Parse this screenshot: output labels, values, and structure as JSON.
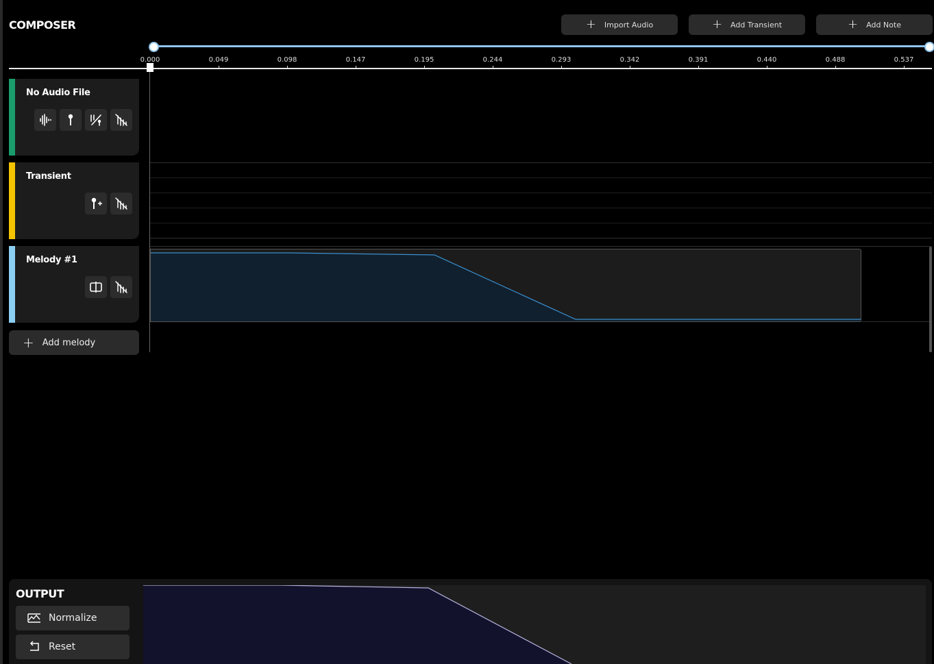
{
  "app": {
    "title": "COMPOSER"
  },
  "header_buttons": {
    "import_audio": "Import Audio",
    "add_transient": "Add Transient",
    "add_note": "Add Note"
  },
  "ruler": {
    "ticks": [
      "0.000",
      "0.049",
      "0.098",
      "0.147",
      "0.195",
      "0.244",
      "0.293",
      "0.342",
      "0.391",
      "0.440",
      "0.488",
      "0.537"
    ]
  },
  "tracks": [
    {
      "name": "No Audio File",
      "color": "#1a9c6c",
      "icons": [
        "waveform-icon",
        "transient-pin-icon",
        "auto-transient-icon",
        "clear-icon"
      ]
    },
    {
      "name": "Transient",
      "color": "#f4c400",
      "icons": [
        "add-transient-icon",
        "clear-icon"
      ]
    },
    {
      "name": "Melody #1",
      "color": "#8ccff2",
      "icons": [
        "split-icon",
        "clear-icon"
      ]
    }
  ],
  "add_melody": {
    "label": "Add melody"
  },
  "output": {
    "title": "OUTPUT",
    "normalize_label": "Normalize",
    "reset_label": "Reset"
  },
  "colors": {
    "accent": "#8fc4f0",
    "melody_line": "#3a90d0",
    "melody_fill": "#11202e",
    "output_line": "#b8b4e0",
    "output_fill": "#12122c"
  }
}
